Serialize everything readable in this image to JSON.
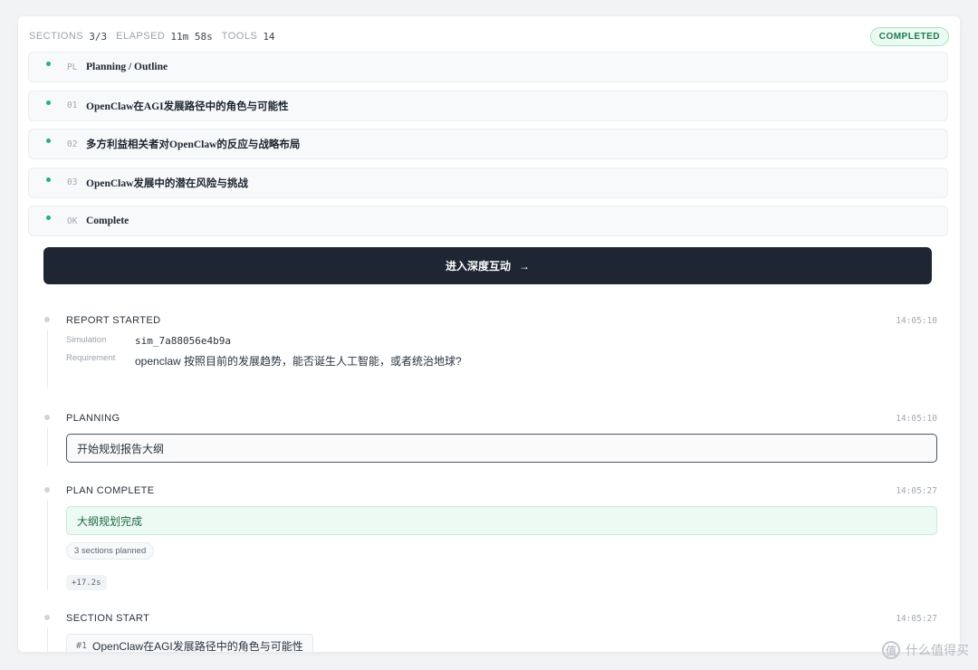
{
  "stats": {
    "sections_label": "SECTIONS",
    "sections_value": "3/3",
    "elapsed_label": "ELAPSED",
    "elapsed_value": "11m 58s",
    "tools_label": "TOOLS",
    "tools_value": "14",
    "status_badge": "COMPLETED"
  },
  "sections": [
    {
      "code": "PL",
      "title": "Planning / Outline"
    },
    {
      "code": "01",
      "title": "OpenClaw在AGI发展路径中的角色与可能性"
    },
    {
      "code": "02",
      "title": "多方利益相关者对OpenClaw的反应与战略布局"
    },
    {
      "code": "03",
      "title": "OpenClaw发展中的潜在风险与挑战"
    },
    {
      "code": "OK",
      "title": "Complete"
    }
  ],
  "cta": {
    "label": "进入深度互动",
    "arrow_icon": "arrow-right-icon",
    "arrow_glyph": "→"
  },
  "events": {
    "report_started": {
      "title": "REPORT STARTED",
      "time": "14:05:10",
      "simulation_label": "Simulation",
      "simulation_value": "sim_7a88056e4b9a",
      "requirement_label": "Requirement",
      "requirement_value": "openclaw 按照目前的发展趋势，能否诞生人工智能，或者统治地球?"
    },
    "planning": {
      "title": "PLANNING",
      "time": "14:05:10",
      "message": "开始规划报告大纲"
    },
    "plan_complete": {
      "title": "PLAN COMPLETE",
      "time": "14:05:27",
      "message": "大纲规划完成",
      "pill": "3 sections planned",
      "duration": "+17.2s"
    },
    "section_start": {
      "title": "SECTION START",
      "time": "14:05:27",
      "number": "#1",
      "section_title": "OpenClaw在AGI发展路径中的角色与可能性"
    }
  },
  "watermark": {
    "icon": "zhi-icon",
    "glyph": "值",
    "text": "什么值得买"
  },
  "colors": {
    "accent_green": "#22b07d",
    "cta_bg": "#1d2632",
    "badge_green": "#1e7a4c"
  }
}
